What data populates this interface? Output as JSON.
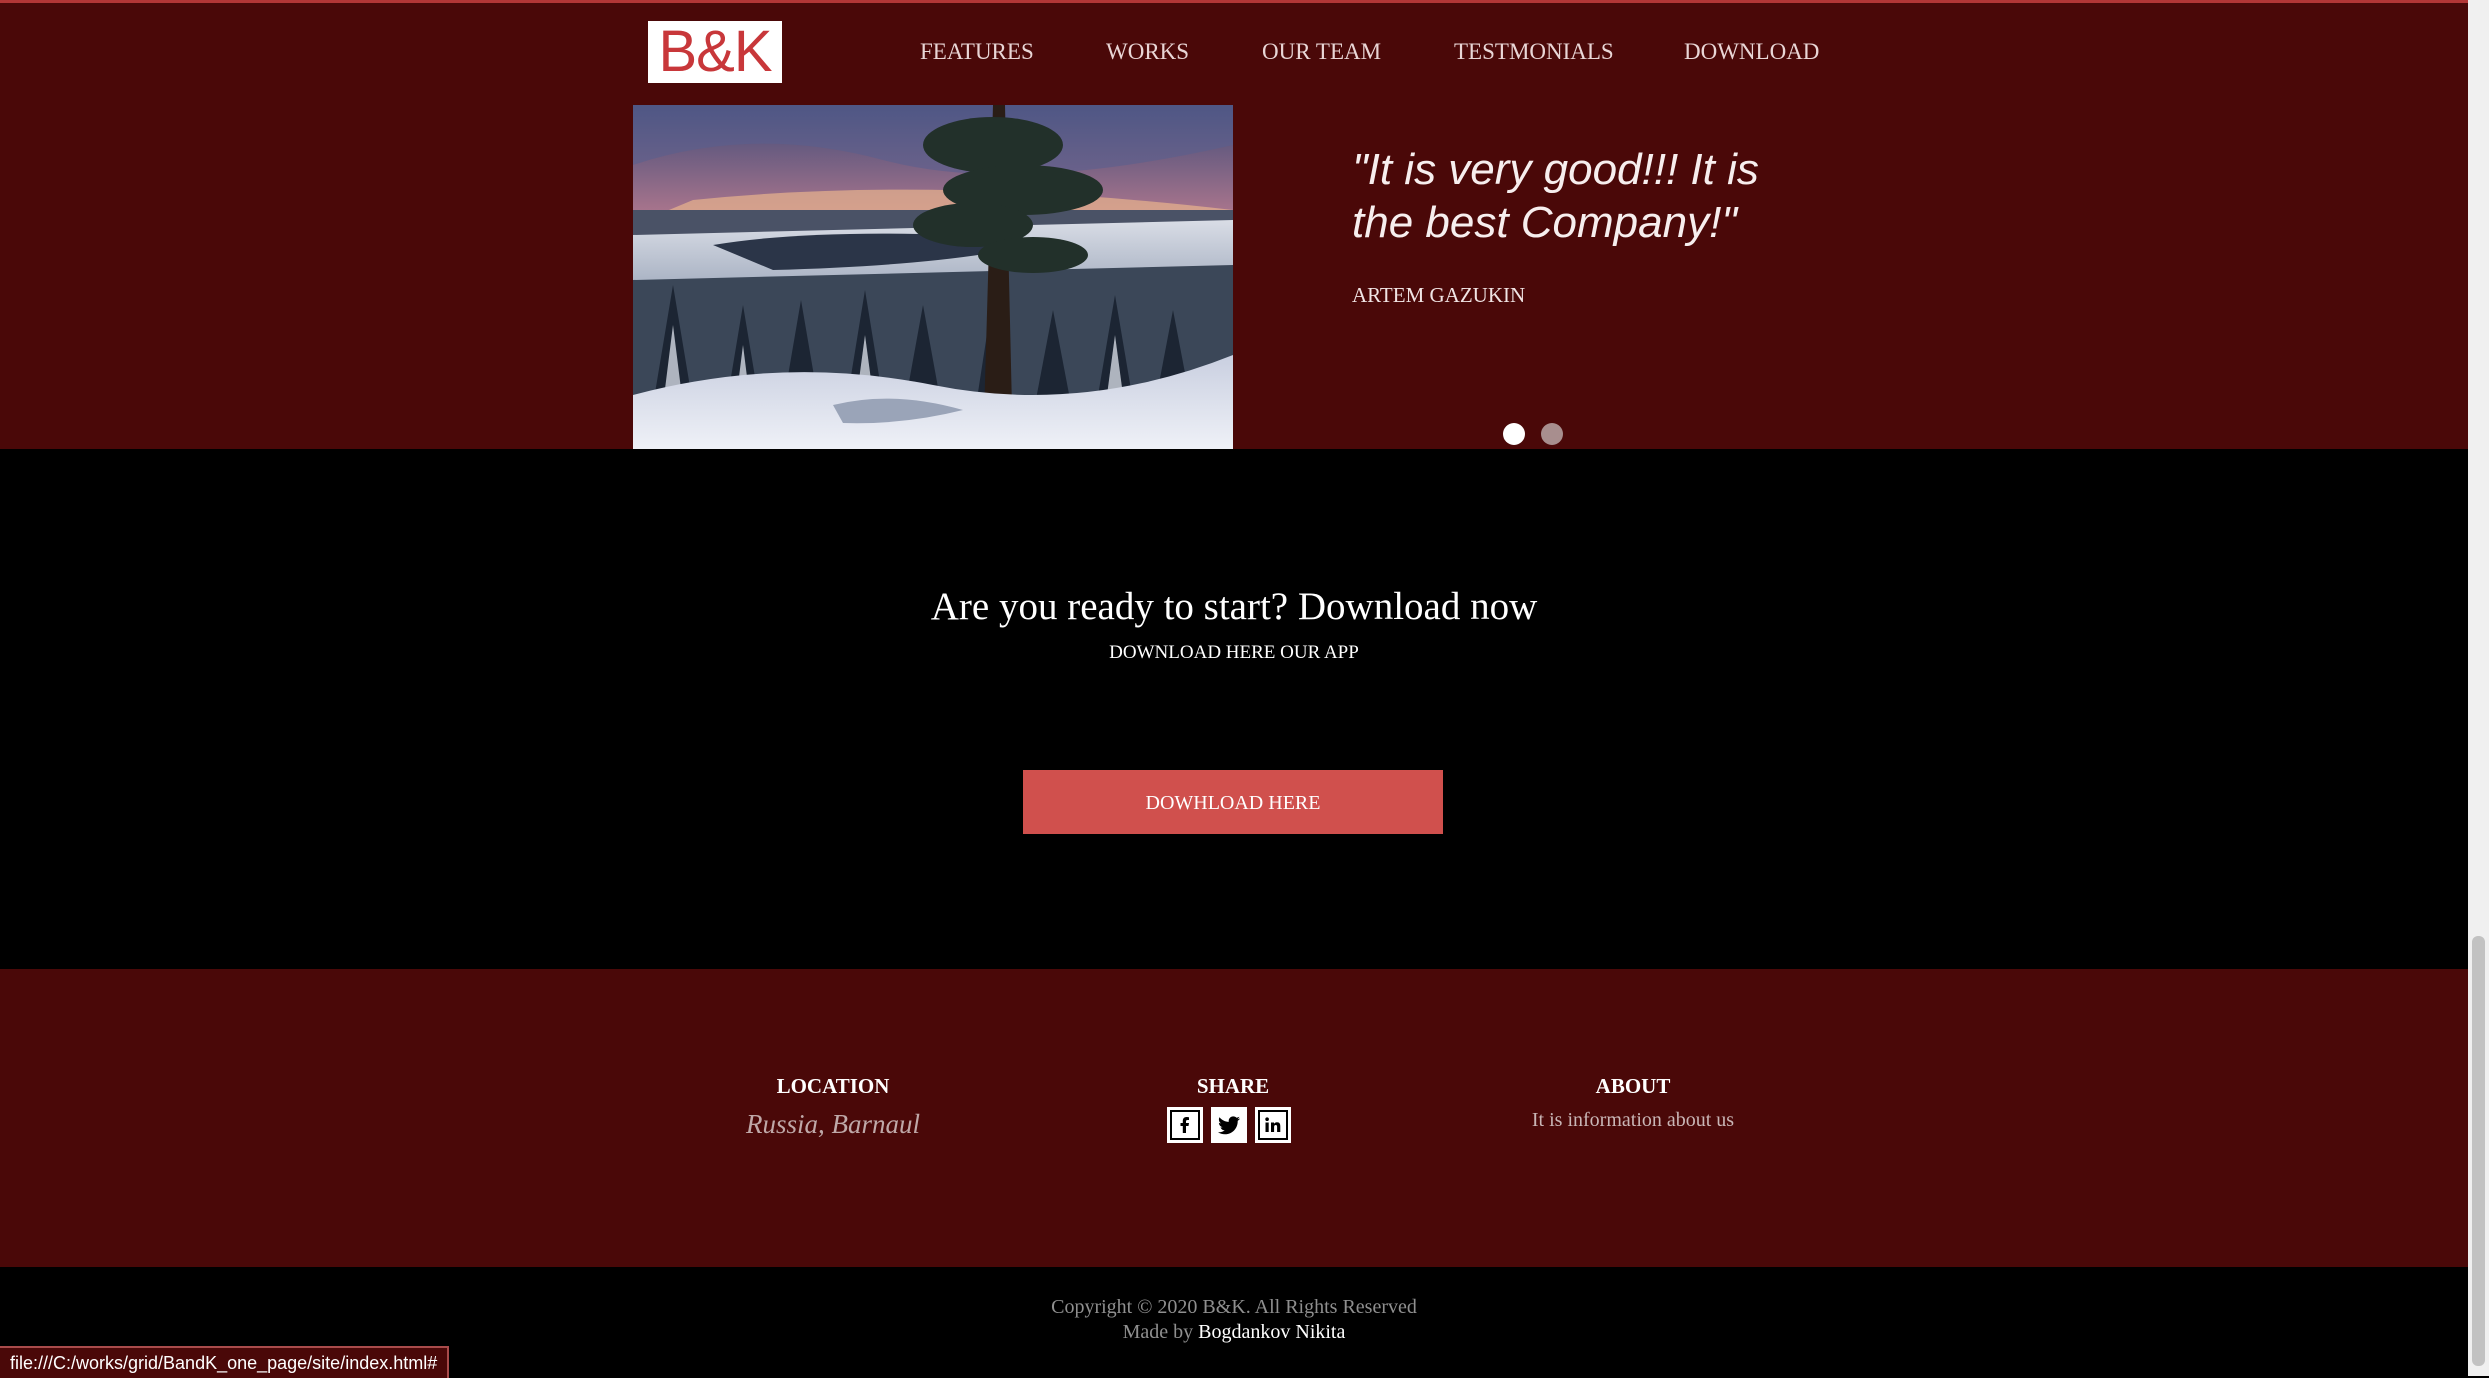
{
  "header": {
    "logo_text": "B&K",
    "nav": [
      {
        "label": "FEATURES"
      },
      {
        "label": "WORKS"
      },
      {
        "label": "OUR TEAM"
      },
      {
        "label": "TESTMONIALS"
      },
      {
        "label": "DOWNLOAD"
      }
    ]
  },
  "testimonial": {
    "quote": "\"It is very good!!! It is the best Company!\"",
    "author": "ARTEM GAZUKIN",
    "active_slide": 1,
    "slide_count": 2
  },
  "cta": {
    "title": "Are you ready to start? Download now",
    "subtitle": "DOWNLOAD HERE OUR APP",
    "button_label": "DOWHLOAD HERE"
  },
  "footer": {
    "location_title": "LOCATION",
    "location_text": "Russia, Barnaul",
    "share_title": "SHARE",
    "social_icons": [
      "facebook-icon",
      "twitter-icon",
      "linkedin-icon"
    ],
    "about_title": "ABOUT",
    "about_text": "It is information about us"
  },
  "bottom": {
    "copyright": "Copyright © 2020 B&K. All Rights Reserved",
    "made_by_prefix": "Made by",
    "made_by_name": "Bogdankov Nikita"
  },
  "status_bar": {
    "url": "file:///C:/works/grid/BandK_one_page/site/index.html#"
  },
  "colors": {
    "maroon_bg": "#4a0808",
    "accent_red": "#d0504d",
    "logo_red": "#c8373a"
  }
}
